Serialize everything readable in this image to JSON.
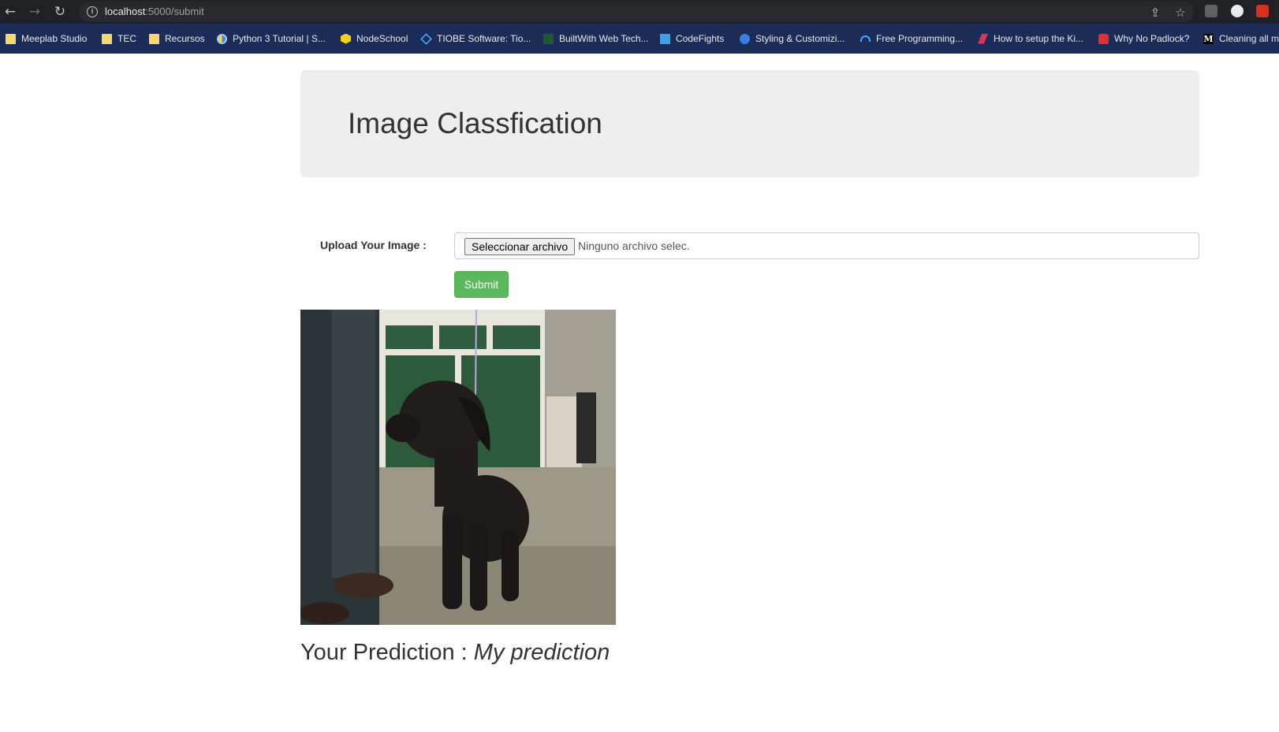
{
  "browser": {
    "url_host": "localhost",
    "url_path": ":5000/submit",
    "bookmarks": [
      {
        "label": "Meeplab Studio",
        "icon": "folder-icon"
      },
      {
        "label": "TEC",
        "icon": "folder-icon"
      },
      {
        "label": "Recursos",
        "icon": "folder-icon"
      },
      {
        "label": "Python 3 Tutorial | S...",
        "icon": "python-icon"
      },
      {
        "label": "NodeSchool",
        "icon": "nodeschool-icon"
      },
      {
        "label": "TIOBE Software: Tio...",
        "icon": "tiobe-icon"
      },
      {
        "label": "BuiltWith Web Tech...",
        "icon": "builtwith-icon"
      },
      {
        "label": "CodeFights",
        "icon": "codefights-icon"
      },
      {
        "label": "Styling & Customizi...",
        "icon": "styling-icon"
      },
      {
        "label": "Free Programming...",
        "icon": "free-programming-icon"
      },
      {
        "label": "How to setup the Ki...",
        "icon": "kibana-icon"
      },
      {
        "label": "Why No Padlock?",
        "icon": "padlock-icon"
      },
      {
        "label": "Cleaning all m",
        "icon": "medium-icon"
      }
    ]
  },
  "page": {
    "title": "Image Classfication",
    "upload_label": "Upload Your Image :",
    "file_button": "Seleccionar archivo",
    "file_status": "Ninguno archivo selec.",
    "submit_label": "Submit",
    "prediction_prefix": "Your Prediction : ",
    "prediction_value": "My prediction"
  },
  "colors": {
    "jumbotron_bg": "#eeeeee",
    "submit_bg": "#5cb85c",
    "bookmarks_bar": "#1a2c57",
    "toolbar": "#202124"
  }
}
